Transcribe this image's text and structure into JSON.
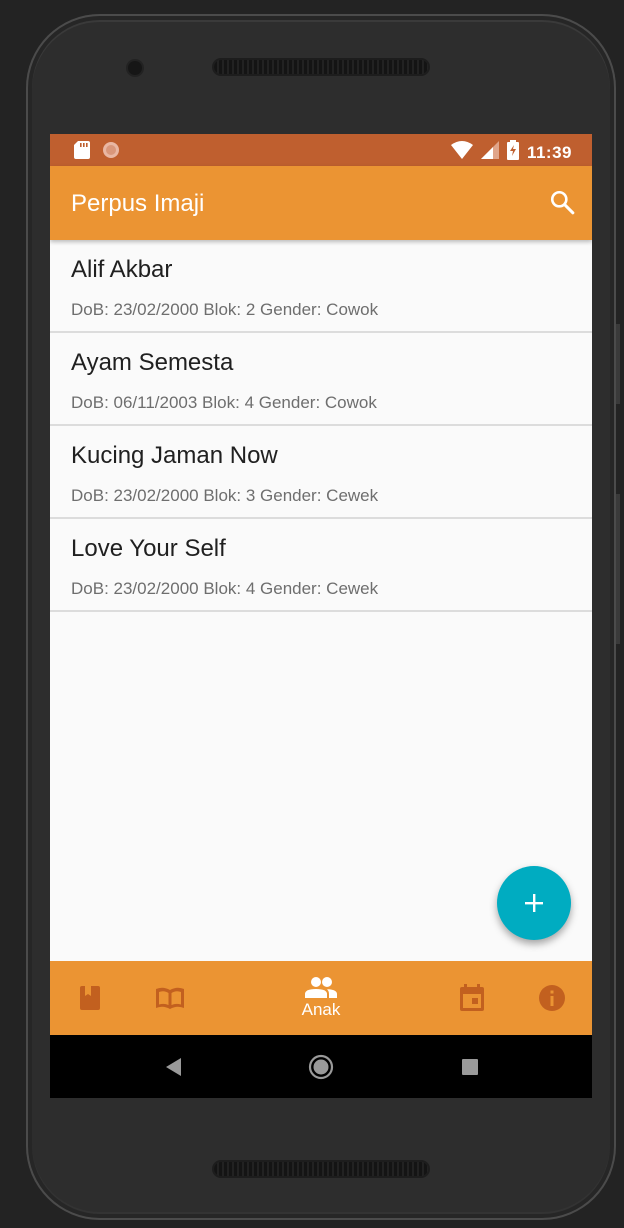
{
  "status": {
    "time": "11:39",
    "icons": [
      "sd-card-icon",
      "sync-icon",
      "wifi-icon",
      "signal-icon",
      "battery-charging-icon"
    ]
  },
  "appbar": {
    "title": "Perpus Imaji",
    "action_icon": "search-icon"
  },
  "items": [
    {
      "name": "Alif Akbar",
      "meta": "DoB: 23/02/2000 Blok: 2 Gender: Cowok"
    },
    {
      "name": "Ayam Semesta",
      "meta": "DoB: 06/11/2003 Blok: 4 Gender: Cowok"
    },
    {
      "name": "Kucing Jaman Now",
      "meta": "DoB: 23/02/2000 Blok: 3 Gender: Cewek"
    },
    {
      "name": "Love Your Self",
      "meta": "DoB: 23/02/2000 Blok: 4 Gender: Cewek"
    }
  ],
  "fab": {
    "icon": "plus-icon"
  },
  "bottom_nav": {
    "active_label": "Anak",
    "icons": [
      "book-icon",
      "open-book-icon",
      "people-icon",
      "calendar-icon",
      "info-icon"
    ]
  },
  "colors": {
    "status_bar": "#bf5f2f",
    "primary": "#eb9433",
    "accent": "#00acc1",
    "inactive_nav_icon": "#c2601f"
  }
}
